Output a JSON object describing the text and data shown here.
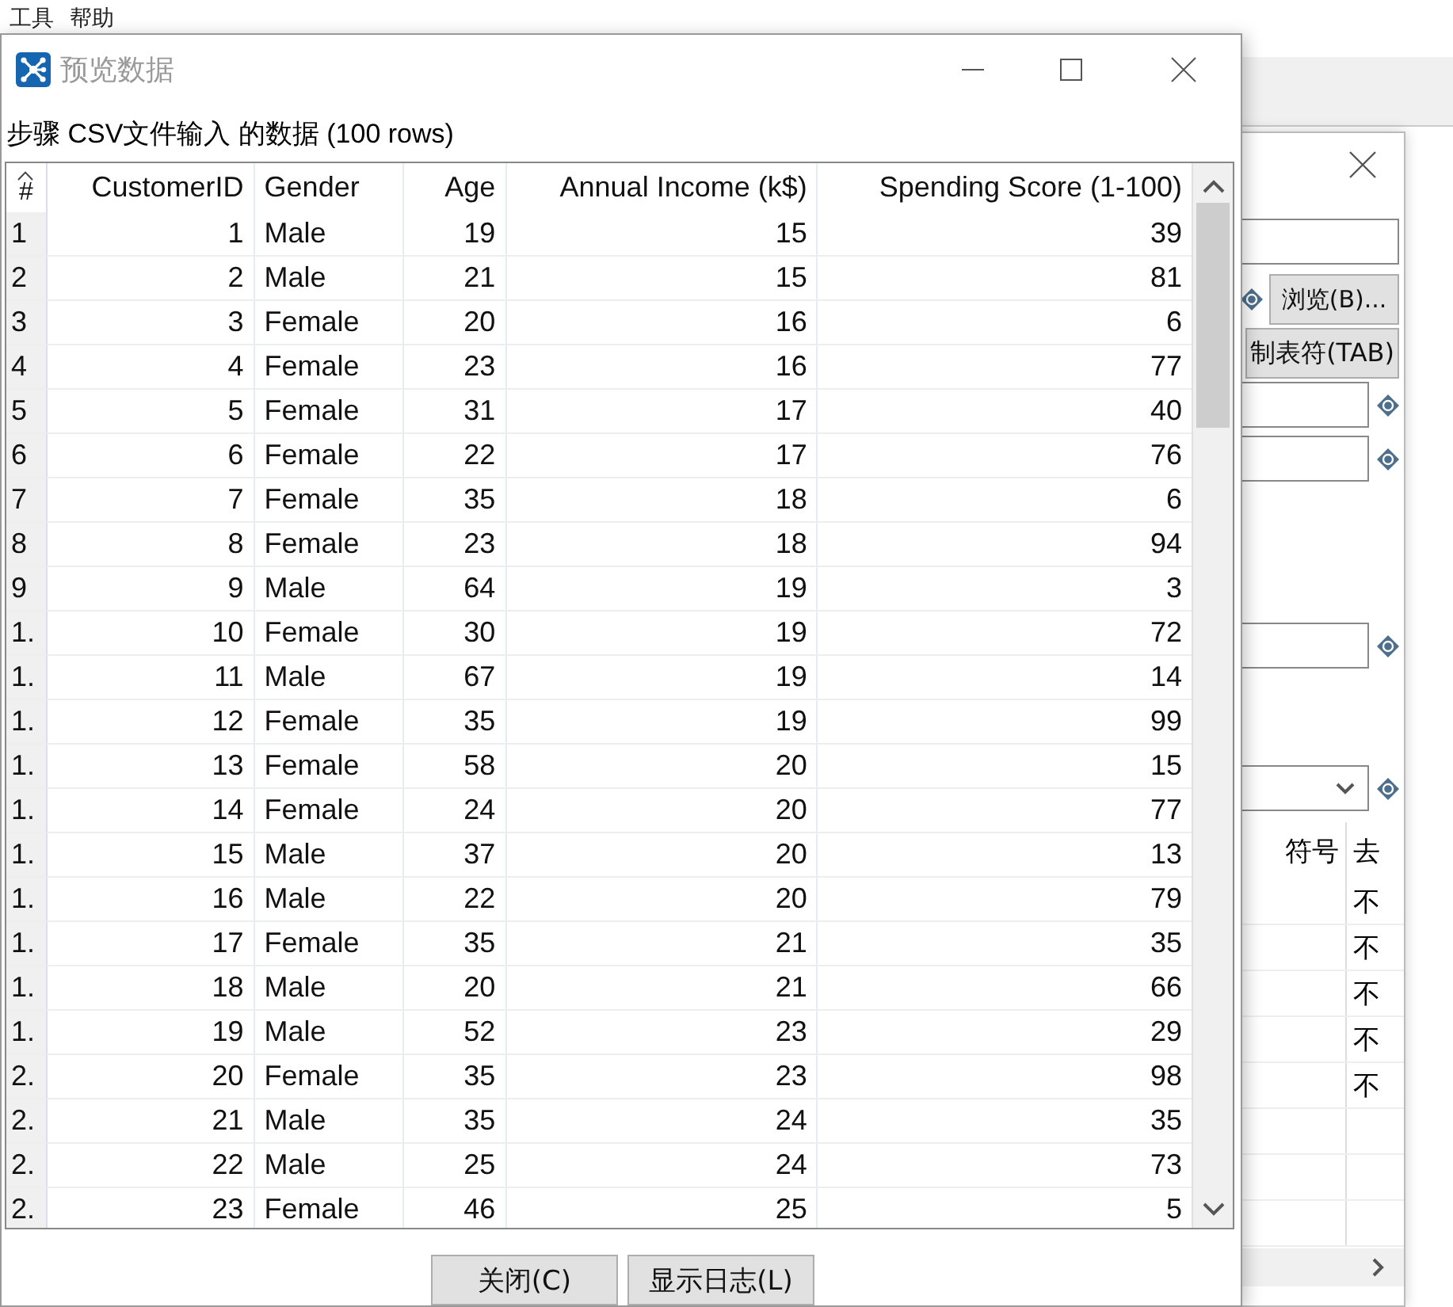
{
  "main_window": {
    "menu": [
      "工具",
      "帮助"
    ]
  },
  "back_dialog": {
    "browse_button": "浏览(B)...",
    "tab_button": "制表符(TAB)",
    "table": {
      "columns": [
        "符号",
        "去"
      ],
      "rows": [
        "不",
        "不",
        "不",
        "不",
        "不"
      ]
    }
  },
  "dialog": {
    "title": "预览数据",
    "caption": "步骤 CSV文件输入 的数据  (100 rows)",
    "table": {
      "columns": [
        "#",
        "CustomerID",
        "Gender",
        "Age",
        "Annual Income (k$)",
        "Spending Score (1-100)"
      ],
      "rows": [
        [
          "1",
          "1",
          "Male",
          "19",
          "15",
          "39"
        ],
        [
          "2",
          "2",
          "Male",
          "21",
          "15",
          "81"
        ],
        [
          "3",
          "3",
          "Female",
          "20",
          "16",
          "6"
        ],
        [
          "4",
          "4",
          "Female",
          "23",
          "16",
          "77"
        ],
        [
          "5",
          "5",
          "Female",
          "31",
          "17",
          "40"
        ],
        [
          "6",
          "6",
          "Female",
          "22",
          "17",
          "76"
        ],
        [
          "7",
          "7",
          "Female",
          "35",
          "18",
          "6"
        ],
        [
          "8",
          "8",
          "Female",
          "23",
          "18",
          "94"
        ],
        [
          "9",
          "9",
          "Male",
          "64",
          "19",
          "3"
        ],
        [
          "1.",
          "10",
          "Female",
          "30",
          "19",
          "72"
        ],
        [
          "1.",
          "11",
          "Male",
          "67",
          "19",
          "14"
        ],
        [
          "1.",
          "12",
          "Female",
          "35",
          "19",
          "99"
        ],
        [
          "1.",
          "13",
          "Female",
          "58",
          "20",
          "15"
        ],
        [
          "1.",
          "14",
          "Female",
          "24",
          "20",
          "77"
        ],
        [
          "1.",
          "15",
          "Male",
          "37",
          "20",
          "13"
        ],
        [
          "1.",
          "16",
          "Male",
          "22",
          "20",
          "79"
        ],
        [
          "1.",
          "17",
          "Female",
          "35",
          "21",
          "35"
        ],
        [
          "1.",
          "18",
          "Male",
          "20",
          "21",
          "66"
        ],
        [
          "1.",
          "19",
          "Male",
          "52",
          "23",
          "29"
        ],
        [
          "2.",
          "20",
          "Female",
          "35",
          "23",
          "98"
        ],
        [
          "2.",
          "21",
          "Male",
          "35",
          "24",
          "35"
        ],
        [
          "2.",
          "22",
          "Male",
          "25",
          "24",
          "73"
        ],
        [
          "2.",
          "23",
          "Female",
          "46",
          "25",
          "5"
        ]
      ]
    },
    "buttons": [
      "关闭(C)",
      "显示日志(L)"
    ]
  }
}
